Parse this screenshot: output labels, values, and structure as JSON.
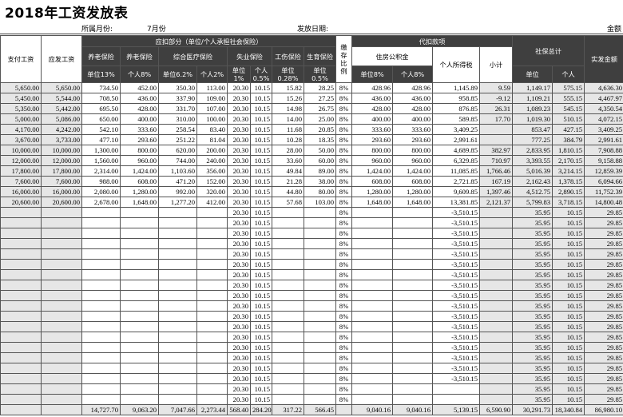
{
  "title": "2018年工资发放表",
  "meta": {
    "month_label": "所属月份:",
    "month_value": "7月份",
    "date_label": "发放日期:",
    "amount_label": "金额"
  },
  "headers": {
    "pay_wage": "支付工资",
    "gross_wage": "应发工资",
    "deduction_group": "应扣部分（单位/个人承担社会保险）",
    "withholding_group": "代扣款项",
    "pension": "养老保险",
    "pension2": "养老保险",
    "medical": "综合医疗保险",
    "unemployment": "失业保险",
    "injury": "工伤保险",
    "maternity": "生育保险",
    "deposit_ratio": "缴存比例",
    "housing_fund": "住房公积金",
    "income_tax": "个人所得税",
    "subtotal": "小计",
    "social_total": "社保总计",
    "net_pay": "实发金额",
    "pension_unit": "单位13%",
    "pension_personal": "个人8%",
    "medical_unit": "单位6.2%",
    "medical_personal": "个人2%",
    "unemp_unit": "单位1%",
    "unemp_personal": "个人0.5%",
    "injury_unit": "单位0.28%",
    "maternity_unit": "单位0.5%",
    "hf_unit": "单位8%",
    "hf_personal": "个人8%",
    "st_unit": "单位",
    "st_personal": "个人"
  },
  "rows": [
    [
      "5,650.00",
      "5,650.00",
      "734.50",
      "452.00",
      "350.30",
      "113.00",
      "20.30",
      "10.15",
      "15.82",
      "28.25",
      "8%",
      "428.96",
      "428.96",
      "1,145.89",
      "9.59",
      "1,149.17",
      "575.15",
      "4,636.30"
    ],
    [
      "5,450.00",
      "5,544.00",
      "708.50",
      "436.00",
      "337.90",
      "109.00",
      "20.30",
      "10.15",
      "15.26",
      "27.25",
      "8%",
      "436.00",
      "436.00",
      "958.85",
      "-9.12",
      "1,109.21",
      "555.15",
      "4,467.97"
    ],
    [
      "5,350.00",
      "5,442.00",
      "695.50",
      "428.00",
      "331.70",
      "107.00",
      "20.30",
      "10.15",
      "14.98",
      "26.75",
      "8%",
      "428.00",
      "428.00",
      "876.85",
      "26.31",
      "1,089.23",
      "545.15",
      "4,350.54"
    ],
    [
      "5,000.00",
      "5,086.00",
      "650.00",
      "400.00",
      "310.00",
      "100.00",
      "20.30",
      "10.15",
      "14.00",
      "25.00",
      "8%",
      "400.00",
      "400.00",
      "589.85",
      "17.70",
      "1,019.30",
      "510.15",
      "4,072.15"
    ],
    [
      "4,170.00",
      "4,242.00",
      "542.10",
      "333.60",
      "258.54",
      "83.40",
      "20.30",
      "10.15",
      "11.68",
      "20.85",
      "8%",
      "333.60",
      "333.60",
      "3,409.25",
      "",
      "853.47",
      "427.15",
      "3,409.25"
    ],
    [
      "3,670.00",
      "3,733.00",
      "477.10",
      "293.60",
      "251.22",
      "81.04",
      "20.30",
      "10.15",
      "10.28",
      "18.35",
      "8%",
      "293.60",
      "293.60",
      "2,991.61",
      "",
      "777.25",
      "384.79",
      "2,991.61"
    ],
    [
      "10,000.00",
      "10,000.00",
      "1,300.00",
      "800.00",
      "620.00",
      "200.00",
      "20.30",
      "10.15",
      "28.00",
      "50.00",
      "8%",
      "800.00",
      "800.00",
      "4,689.85",
      "382.97",
      "2,833.95",
      "1,810.15",
      "7,908.88"
    ],
    [
      "12,000.00",
      "12,000.00",
      "1,560.00",
      "960.00",
      "744.00",
      "240.00",
      "20.30",
      "10.15",
      "33.60",
      "60.00",
      "8%",
      "960.00",
      "960.00",
      "6,329.85",
      "710.97",
      "3,393.55",
      "2,170.15",
      "9,158.88"
    ],
    [
      "17,800.00",
      "17,800.00",
      "2,314.00",
      "1,424.00",
      "1,103.60",
      "356.00",
      "20.30",
      "10.15",
      "49.84",
      "89.00",
      "8%",
      "1,424.00",
      "1,424.00",
      "11,085.85",
      "1,766.46",
      "5,016.39",
      "3,214.15",
      "12,859.39"
    ],
    [
      "7,600.00",
      "7,600.00",
      "988.00",
      "608.00",
      "471.20",
      "152.00",
      "20.30",
      "10.15",
      "21.28",
      "38.00",
      "8%",
      "608.00",
      "608.00",
      "2,721.85",
      "167.19",
      "2,162.43",
      "1,378.15",
      "6,094.66"
    ],
    [
      "16,000.00",
      "16,000.00",
      "2,080.00",
      "1,280.00",
      "992.00",
      "320.00",
      "20.30",
      "10.15",
      "44.80",
      "80.00",
      "8%",
      "1,280.00",
      "1,280.00",
      "9,609.85",
      "1,397.46",
      "4,512.75",
      "2,890.15",
      "11,752.39"
    ],
    [
      "20,600.00",
      "20,600.00",
      "2,678.00",
      "1,648.00",
      "1,277.20",
      "412.00",
      "20.30",
      "10.15",
      "57.68",
      "103.00",
      "8%",
      "1,648.00",
      "1,648.00",
      "13,381.85",
      "2,121.37",
      "5,799.83",
      "3,718.15",
      "14,800.48"
    ]
  ],
  "blank_row": {
    "unemp_unit": "20.30",
    "unemp_personal": "10.15",
    "ratio": "8%",
    "tax": "-3,510.15",
    "st_unit": "35.95",
    "st_personal": "10.15",
    "net": "29.85",
    "count": 19,
    "count_without_tax": 2
  },
  "totals": [
    "",
    "",
    "14,727.70",
    "9,063.20",
    "7,047.66",
    "2,273.44",
    "568.40",
    "284.20",
    "317.22",
    "566.45",
    "",
    "9,040.16",
    "9,040.16",
    "5,139.15",
    "6,590.90",
    "30,291.73",
    "18,340.84",
    "86,980.10"
  ]
}
